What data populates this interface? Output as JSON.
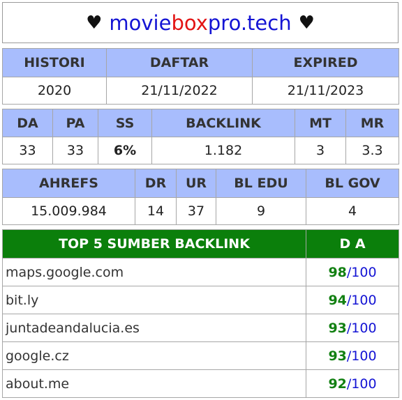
{
  "title": {
    "heart": "♥",
    "part1": "movie",
    "part2": "box",
    "part3": "pro.tech"
  },
  "table1": {
    "headers": [
      "HISTORI",
      "DAFTAR",
      "EXPIRED"
    ],
    "values": [
      "2020",
      "21/11/2022",
      "21/11/2023"
    ]
  },
  "table2": {
    "headers": [
      "DA",
      "PA",
      "SS",
      "BACKLINK",
      "MT",
      "MR"
    ],
    "values": [
      "33",
      "33",
      "6%",
      "1.182",
      "3",
      "3.3"
    ]
  },
  "table3": {
    "headers": [
      "AHREFS",
      "DR",
      "UR",
      "BL EDU",
      "BL GOV"
    ],
    "values": [
      "15.009.984",
      "14",
      "37",
      "9",
      "4"
    ]
  },
  "backlinks": {
    "header_source": "TOP 5 SUMBER BACKLINK",
    "header_da": "D A",
    "max": "100",
    "separator": "/",
    "rows": [
      {
        "site": "maps.google.com",
        "score": "98"
      },
      {
        "site": "bit.ly",
        "score": "94"
      },
      {
        "site": "juntadeandalucia.es",
        "score": "93"
      },
      {
        "site": "google.cz",
        "score": "93"
      },
      {
        "site": "about.me",
        "score": "92"
      }
    ]
  },
  "colors": {
    "header_blue": "#a8bdfd",
    "header_green": "#0b7f0b",
    "score_green": "#128012",
    "brand_blue": "#1414d4",
    "brand_red": "#e31414"
  }
}
